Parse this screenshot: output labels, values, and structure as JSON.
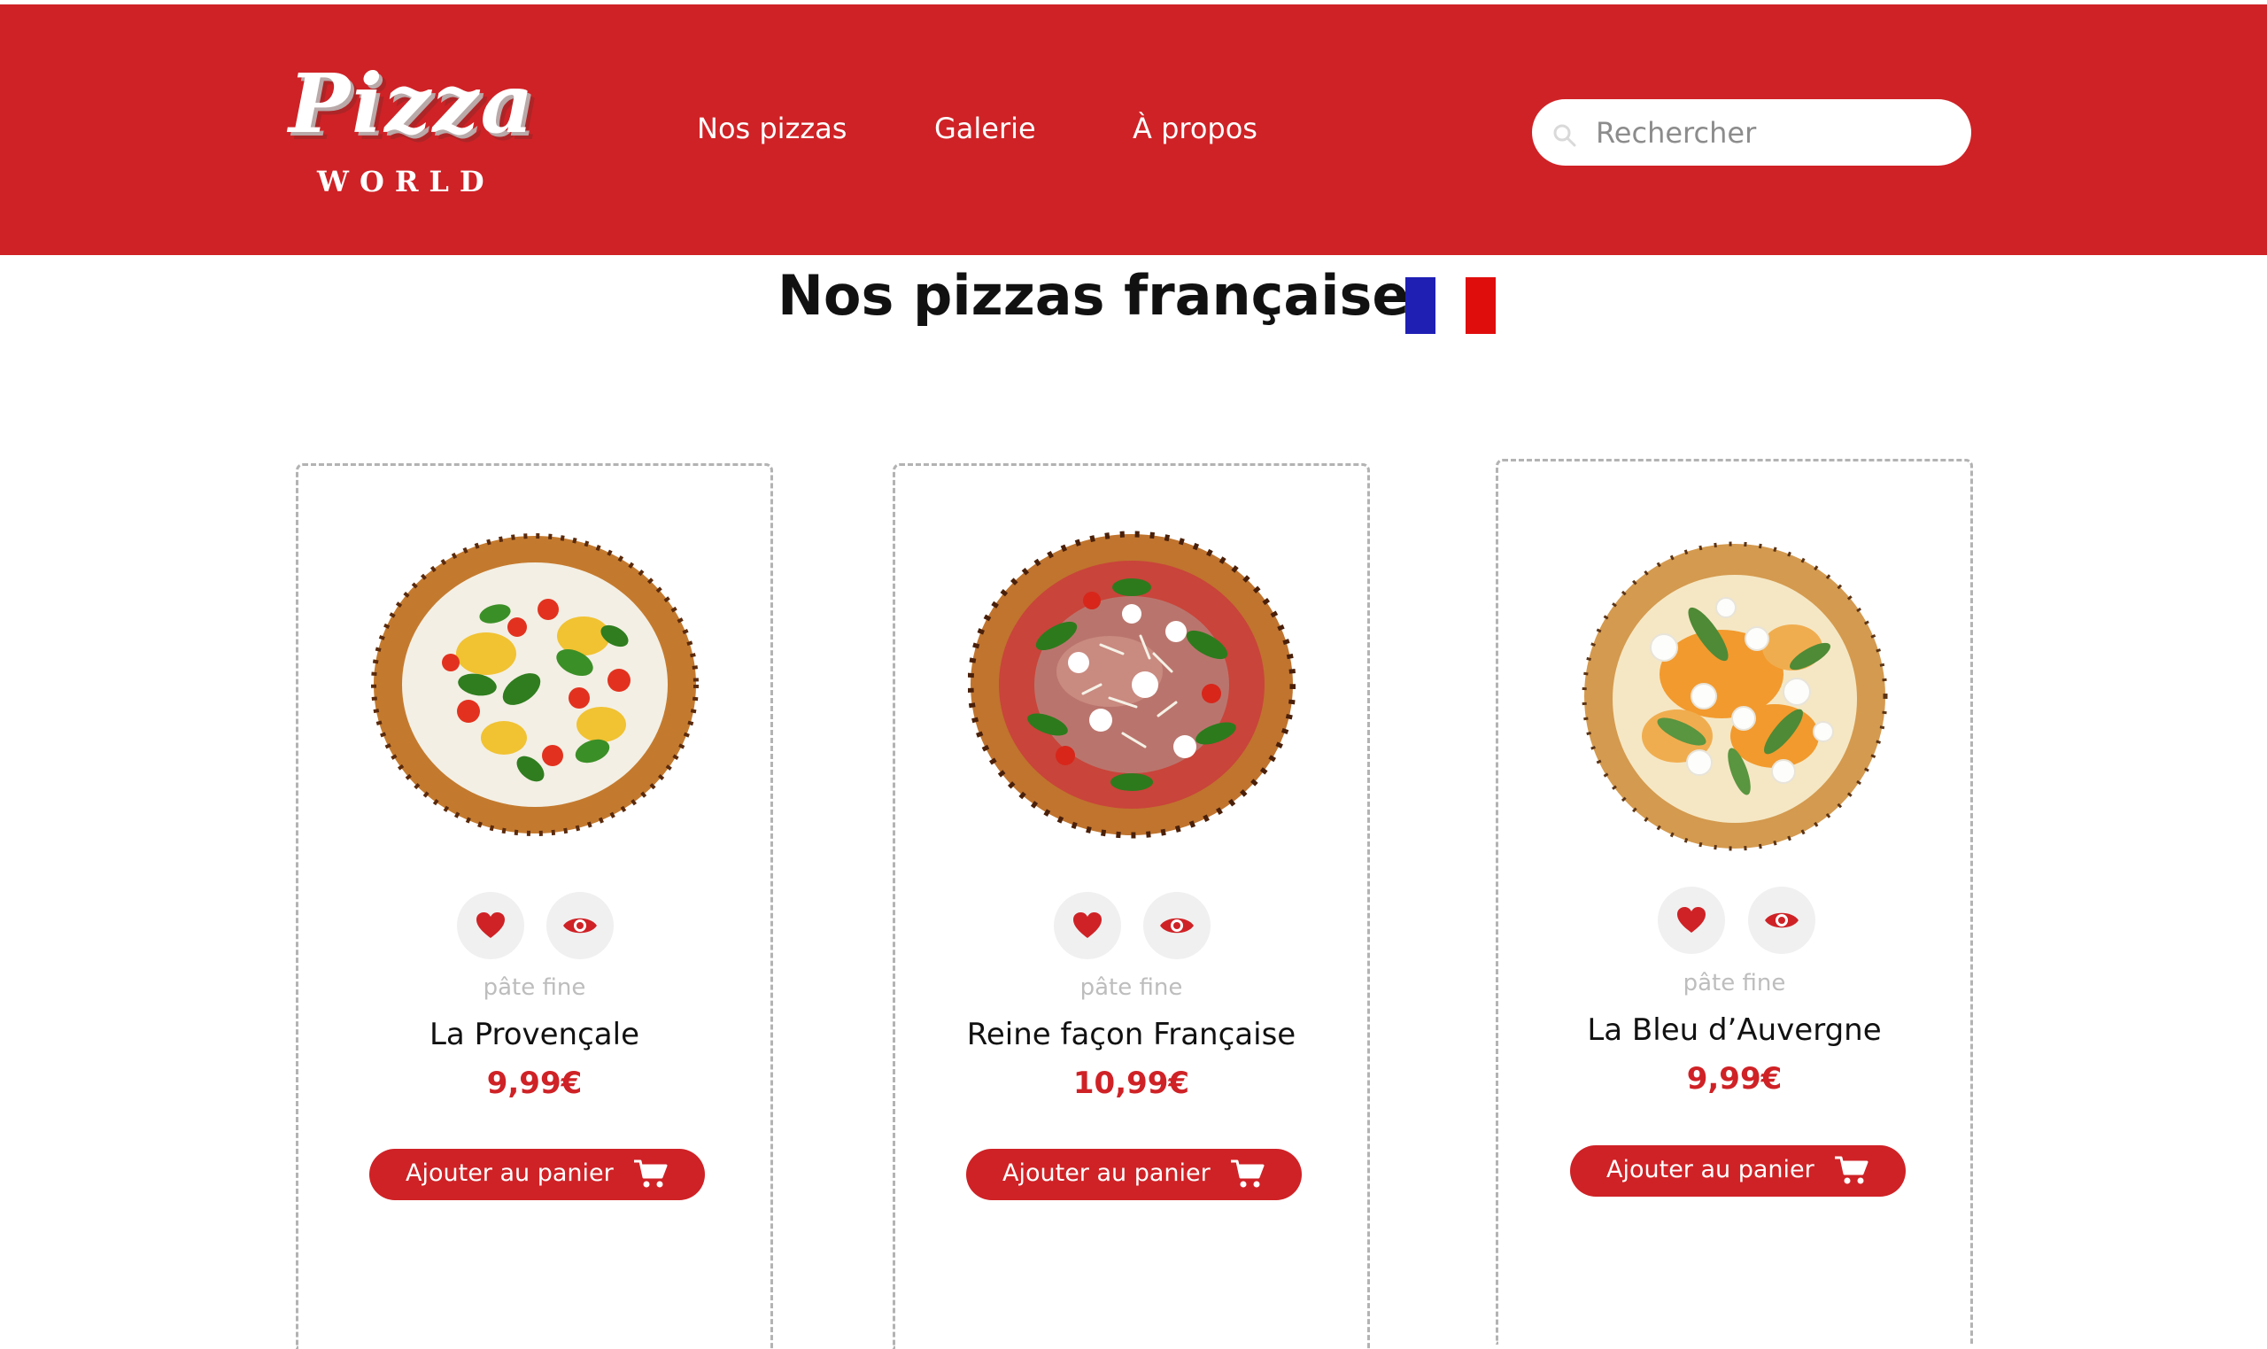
{
  "header": {
    "logo": {
      "script": "Pizza",
      "sub": "WORLD"
    },
    "nav": [
      {
        "label": "Nos pizzas"
      },
      {
        "label": "Galerie"
      },
      {
        "label": "À propos"
      }
    ],
    "search": {
      "placeholder": "Rechercher",
      "value": ""
    }
  },
  "main": {
    "title": "Nos pizzas françaises",
    "flag_colors": [
      "#1f1fb4",
      "#ffffff",
      "#e00d0d"
    ],
    "products": [
      {
        "crust": "pâte fine",
        "name": "La Provençale",
        "price": "9,99€",
        "cart_label": "Ajouter au panier"
      },
      {
        "crust": "pâte fine",
        "name": "Reine façon Française",
        "price": "10,99€",
        "cart_label": "Ajouter au panier"
      },
      {
        "crust": "pâte fine",
        "name": "La Bleu d’Auvergne",
        "price": "9,99€",
        "cart_label": "Ajouter au panier"
      }
    ]
  },
  "colors": {
    "brand_red": "#cf2226",
    "icon_button_bg": "#f0f0f0",
    "muted_text": "#bdbdbd"
  }
}
